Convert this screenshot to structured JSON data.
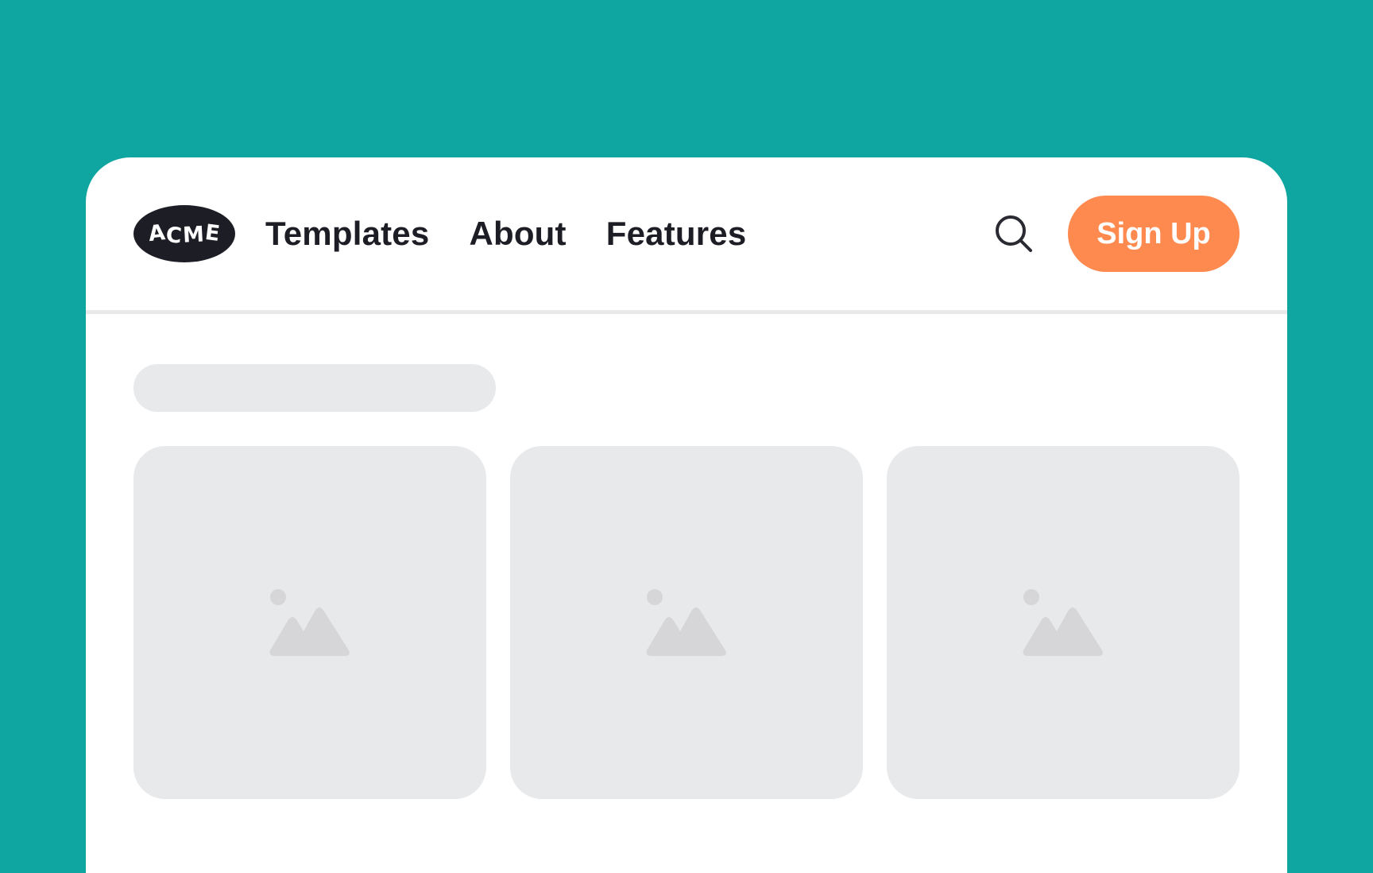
{
  "brand": {
    "logo_text": [
      "A",
      "C",
      "M",
      "E"
    ]
  },
  "nav": {
    "links": [
      {
        "label": "Templates"
      },
      {
        "label": "About"
      },
      {
        "label": "Features"
      }
    ],
    "search_icon": "search-icon",
    "signup_label": "Sign Up"
  },
  "content": {
    "cards": [
      {
        "icon": "image-placeholder-icon"
      },
      {
        "icon": "image-placeholder-icon"
      },
      {
        "icon": "image-placeholder-icon"
      }
    ]
  },
  "colors": {
    "background": "#0fa5a0",
    "window": "#ffffff",
    "logo_bg": "#1d1d26",
    "text": "#1d1d26",
    "accent": "#ff8a50",
    "skeleton": "#e8e9eb",
    "placeholder_icon": "#d6d6d9"
  }
}
